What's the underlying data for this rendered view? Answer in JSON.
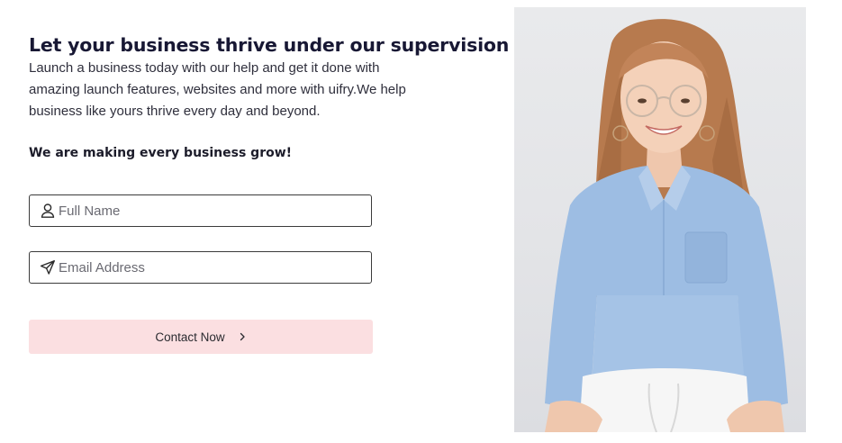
{
  "hero": {
    "headline": "Let your business thrive under our supervision",
    "description": "Launch a business today with our help and get it done with amazing launch features, websites and more with uifry.We help business like yours thrive every day and beyond.",
    "tagline": "We are making every business grow!"
  },
  "form": {
    "full_name": {
      "placeholder": "Full Name",
      "value": "",
      "icon": "user-icon"
    },
    "email": {
      "placeholder": "Email Address",
      "value": "",
      "icon": "send-icon"
    },
    "submit_label": "Contact Now",
    "submit_icon": "chevron-right-icon"
  },
  "colors": {
    "headline": "#181834",
    "button_background": "#fbdfe1",
    "field_border": "#3b3b3b",
    "photo_background": "#e6e7ea"
  }
}
